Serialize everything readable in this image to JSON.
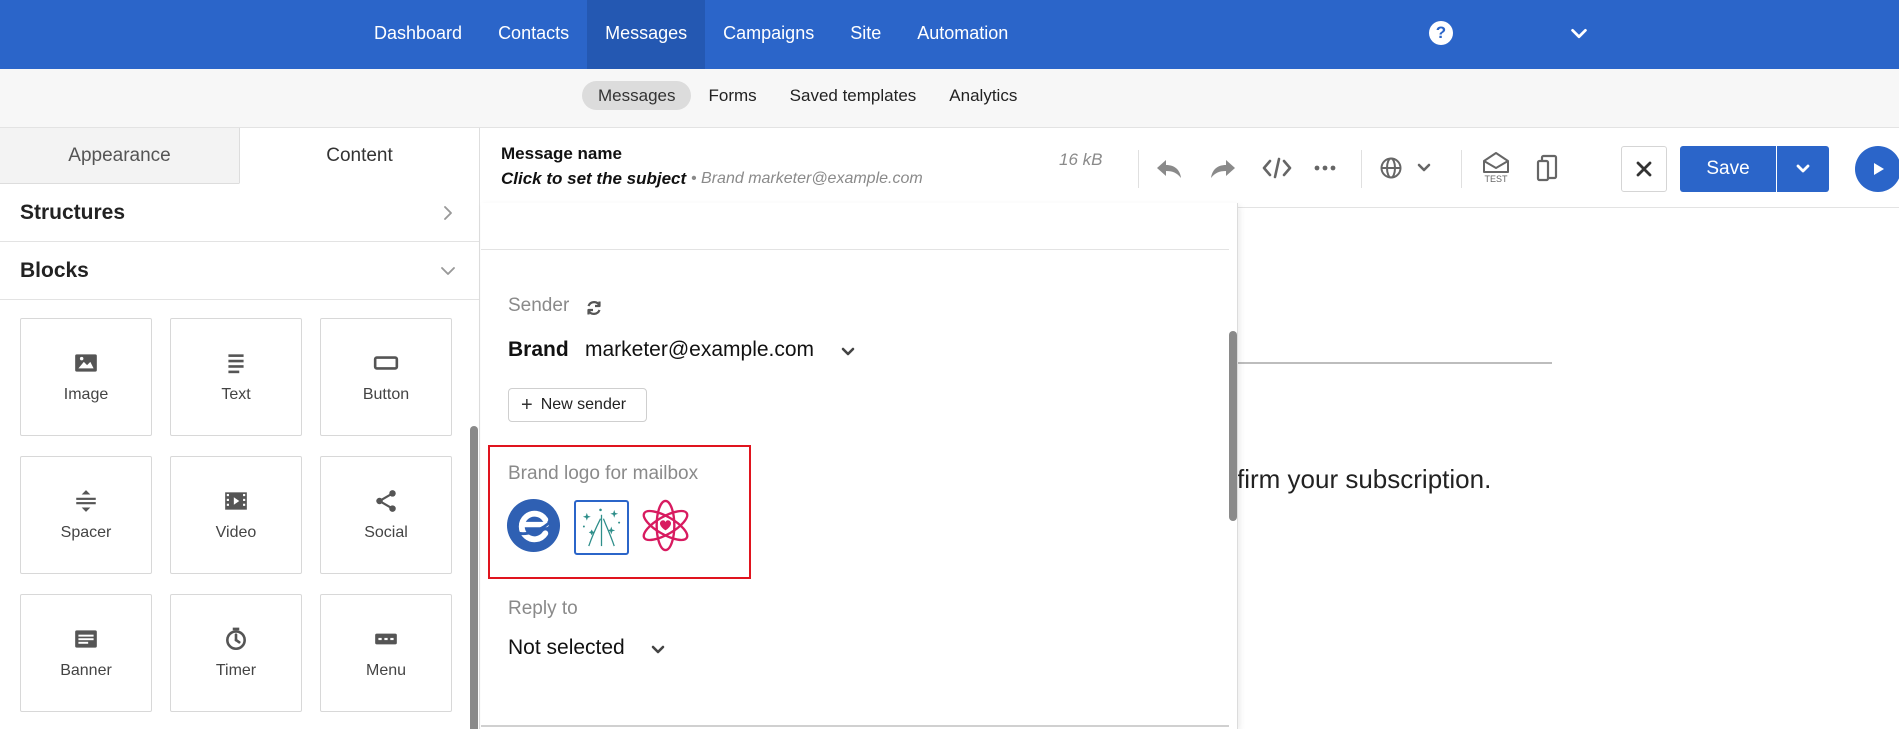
{
  "topnav": {
    "items": [
      "Dashboard",
      "Contacts",
      "Messages",
      "Campaigns",
      "Site",
      "Automation"
    ],
    "active": "Messages",
    "help_glyph": "?",
    "bg_color": "#2b65c9"
  },
  "subnav": {
    "items": [
      "Messages",
      "Forms",
      "Saved templates",
      "Analytics"
    ],
    "active": "Messages"
  },
  "left_panel": {
    "tabs": [
      "Appearance",
      "Content"
    ],
    "active_tab": "Content",
    "sections": [
      "Structures",
      "Blocks"
    ],
    "blocks": [
      {
        "label": "Image",
        "icon": "image-icon"
      },
      {
        "label": "Text",
        "icon": "text-icon"
      },
      {
        "label": "Button",
        "icon": "button-icon"
      },
      {
        "label": "Spacer",
        "icon": "spacer-icon"
      },
      {
        "label": "Video",
        "icon": "video-icon"
      },
      {
        "label": "Social",
        "icon": "share-icon"
      },
      {
        "label": "Banner",
        "icon": "banner-icon"
      },
      {
        "label": "Timer",
        "icon": "timer-icon"
      },
      {
        "label": "Menu",
        "icon": "menu-icon"
      }
    ]
  },
  "editor_header": {
    "message_name": "Message name",
    "subject": "Click to set the subject",
    "sender": "• Brand marketer@example.com",
    "size": "16 kB",
    "test_label": "TEST",
    "save_label": "Save"
  },
  "sender_panel": {
    "sender_label": "Sender",
    "sender_name": "Brand",
    "sender_email": "marketer@example.com",
    "new_sender_label": "New sender",
    "brand_logo_label": "Brand logo for mailbox",
    "logos": [
      "e-circle-logo",
      "sparkles-logo",
      "atom-heart-logo"
    ],
    "reply_label": "Reply to",
    "reply_value": "Not selected"
  },
  "canvas": {
    "visible_text": "firm your subscription."
  }
}
